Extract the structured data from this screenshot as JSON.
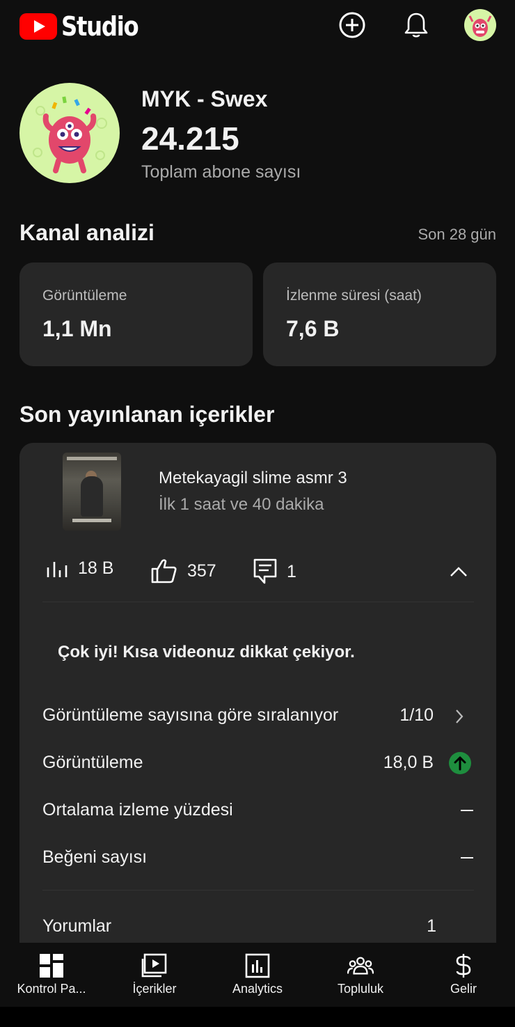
{
  "app": {
    "logo_text": "Studio"
  },
  "topbar": {
    "icons": [
      "create-icon",
      "notifications-icon",
      "account-avatar"
    ]
  },
  "channel": {
    "name": "MYK - Swex",
    "subscribers": "24.215",
    "subscribers_label": "Toplam abone sayısı"
  },
  "analytics": {
    "title": "Kanal analizi",
    "period": "Son 28 gün",
    "cards": [
      {
        "label": "Görüntüleme",
        "value": "1,1 Mn"
      },
      {
        "label": "İzlenme süresi (saat)",
        "value": "7,6 B"
      }
    ]
  },
  "recent": {
    "title": "Son yayınlanan içerikler",
    "video": {
      "title": "Metekayagil slime asmr 3",
      "age": "İlk 1 saat ve 40 dakika",
      "views": "18 B",
      "likes": "357",
      "comments": "1"
    },
    "praise": "Çok iyi! Kısa videonuz dikkat çekiyor.",
    "rows": [
      {
        "label": "Görüntüleme sayısına göre sıralanıyor",
        "value": "1/10"
      },
      {
        "label": "Görüntüleme",
        "value": "18,0 B"
      },
      {
        "label": "Ortalama izleme yüzdesi",
        "value": ""
      },
      {
        "label": "Beğeni sayısı",
        "value": ""
      },
      {
        "label": "Yorumlar",
        "value": "1"
      }
    ]
  },
  "nav": [
    {
      "label": "Kontrol Pa...",
      "icon": "dashboard-icon"
    },
    {
      "label": "İçerikler",
      "icon": "content-icon"
    },
    {
      "label": "Analytics",
      "icon": "analytics-icon"
    },
    {
      "label": "Topluluk",
      "icon": "community-icon"
    },
    {
      "label": "Gelir",
      "icon": "earn-icon"
    }
  ],
  "colors": {
    "background": "#0f0f0f",
    "card": "#272727",
    "brand_red": "#ff0000",
    "trend_up": "#1e8e3e",
    "avatar_bg": "#d6f5a6"
  }
}
